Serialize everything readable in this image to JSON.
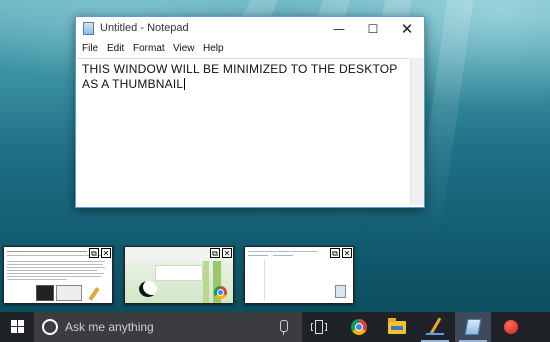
{
  "notepad": {
    "title": "Untitled - Notepad",
    "caption_minimize": "—",
    "caption_maximize": "☐",
    "caption_close": "✕",
    "menu": [
      "File",
      "Edit",
      "Format",
      "View",
      "Help"
    ],
    "content": "THIS WINDOW WILL BE MINIMIZED TO THE DESKTOP AS A THUMBNAIL"
  },
  "thumbnails": [
    {
      "icons": [
        "document-page-icon",
        "pen-icon"
      ]
    },
    {
      "icons": [
        "panda-icon",
        "chrome-icon"
      ]
    },
    {
      "icons": [
        "recycle-bin-icon"
      ]
    }
  ],
  "thumb_controls": {
    "restore": "⧉",
    "close": "✕"
  },
  "taskbar": {
    "search_placeholder": "Ask me anything",
    "apps": [
      "chrome-icon",
      "file-explorer-icon",
      "pen-tool-icon",
      "notepad-icon",
      "record-icon"
    ],
    "colors": {
      "taskbar": "#1f2226",
      "search": "#3a3c40",
      "accent": "#8fb6e0"
    }
  }
}
